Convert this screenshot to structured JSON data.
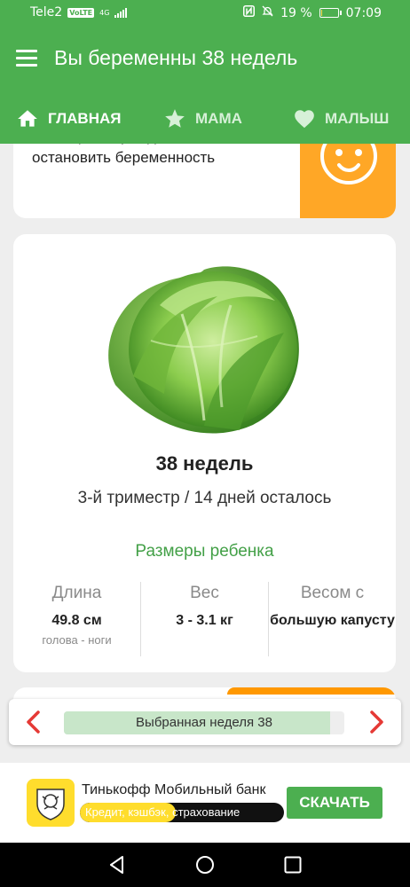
{
  "status_bar": {
    "carrier": "Tele2",
    "volte": "VoLTE",
    "network": "4G",
    "battery_percent": "19 %",
    "battery_level": 0.19,
    "time": "07:09",
    "icons": [
      "nfc-icon",
      "mute-icon",
      "battery-icon",
      "signal-icon"
    ]
  },
  "app_bar": {
    "title": "Вы беременны 38 недель",
    "menu_icon": "hamburger-menu-icon"
  },
  "tabs": [
    {
      "label": "ГЛАВНАЯ",
      "icon": "home-icon",
      "active": true
    },
    {
      "label": "МАМА",
      "icon": "star-icon",
      "active": false
    },
    {
      "label": "МАЛЫШ",
      "icon": "heart-icon",
      "active": false
    }
  ],
  "birth_card": {
    "text": "Сообщить о рождении малыша и остановить беременность",
    "icon": "baby-face-icon"
  },
  "week_card": {
    "image": "cabbage-image",
    "title": "38 недель",
    "subtitle": "3-й триместр / 14 дней осталось",
    "sizes_title": "Размеры ребенка",
    "metrics": [
      {
        "label": "Длина",
        "value": "49.8 см",
        "note": "голова - ноги"
      },
      {
        "label": "Вес",
        "value": "3 - 3.1 кг",
        "note": ""
      },
      {
        "label": "Весом с",
        "value": "большую капусту",
        "note": ""
      }
    ]
  },
  "week_nav": {
    "label": "Выбранная неделя 38",
    "progress": 0.95,
    "prev_icon": "chevron-left-icon",
    "next_icon": "chevron-right-icon"
  },
  "ad": {
    "title": "Тинькофф Мобильный банк",
    "subtitle": "Кредит, кэшбэк, страхование",
    "button": "СКАЧАТЬ",
    "logo_icon": "tinkoff-logo-icon"
  },
  "nav_bar": {
    "icons": [
      "back-triangle-icon",
      "home-circle-icon",
      "recents-square-icon"
    ]
  },
  "colors": {
    "primary": "#4caf50",
    "accent": "#ff9800",
    "sizes_title": "#43a047",
    "ad_yellow": "#ffdd2d"
  }
}
